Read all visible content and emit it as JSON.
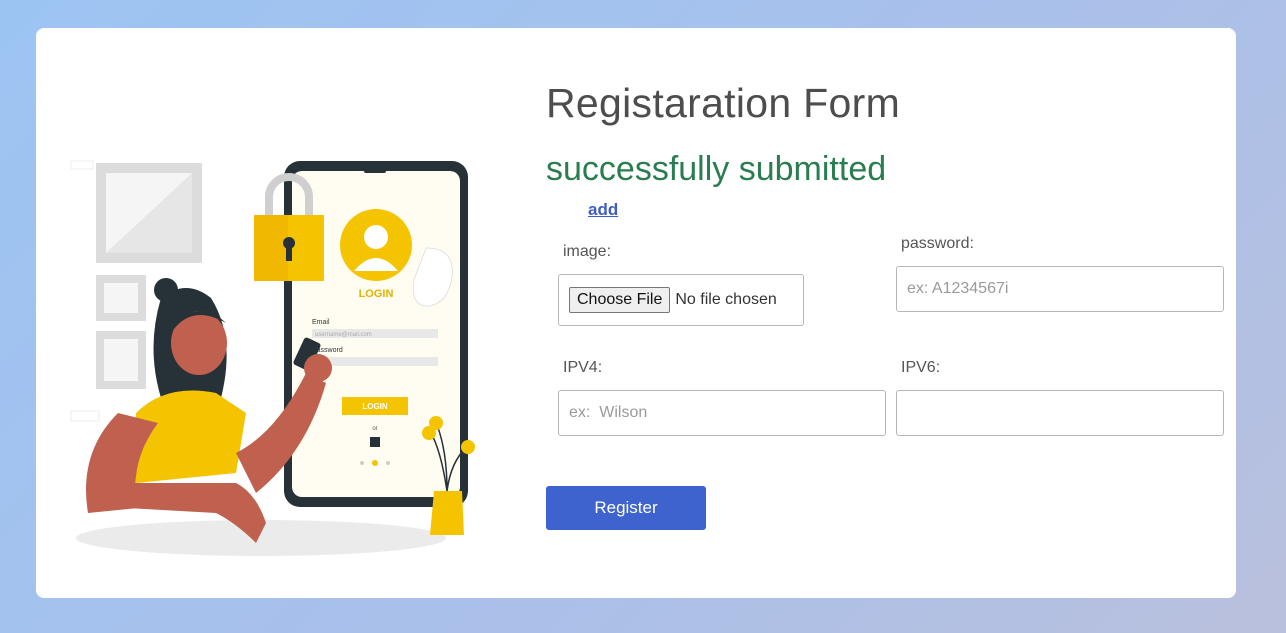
{
  "form": {
    "title": "Registaration Form",
    "success_message": "successfully submitted",
    "add_link": "add",
    "image_label": "image:",
    "choose_file_label": "Choose File",
    "no_file_text": "No file chosen",
    "password_label": "password:",
    "password_placeholder": "ex: A1234567i",
    "ipv4_label": "IPV4:",
    "ipv4_placeholder": "ex:  Wilson",
    "ipv6_label": "IPV6:",
    "ipv6_placeholder": "",
    "register_label": "Register"
  },
  "illustration": {
    "phone_login_title": "LOGIN",
    "email_label": "Email",
    "email_placeholder": "username@mail.com",
    "password_label": "Password",
    "login_button": "LOGIN",
    "or_text": "or"
  },
  "colors": {
    "accent": "#3e63cf",
    "success": "#2a7d4f",
    "yellow": "#f5c400",
    "skin": "#c0604f",
    "phone_frame": "#263238"
  }
}
